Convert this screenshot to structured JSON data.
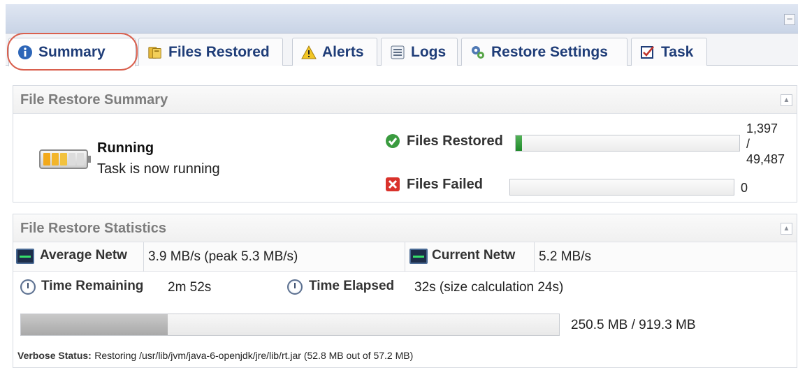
{
  "tabs": [
    {
      "label": "Summary",
      "icon": "info-icon",
      "active": true
    },
    {
      "label": "Files Restored",
      "icon": "folders-icon"
    },
    {
      "label": "Alerts",
      "icon": "warning-icon"
    },
    {
      "label": "Logs",
      "icon": "log-list-icon"
    },
    {
      "label": "Restore Settings",
      "icon": "gear-icon"
    },
    {
      "label": "Task",
      "icon": "task-checkbox-icon"
    }
  ],
  "summary": {
    "title": "File Restore Summary",
    "status_title": "Running",
    "status_text": "Task is now running",
    "files_restored_label": "Files Restored",
    "files_restored_value": "1,397",
    "files_restored_sep": "/",
    "files_restored_total": "49,487",
    "files_restored_fraction": 0.0282,
    "files_failed_label": "Files Failed",
    "files_failed_value": "0",
    "files_failed_fraction": 0
  },
  "stats": {
    "title": "File Restore Statistics",
    "avg_network_label": "Average Netw",
    "avg_network_value": "3.9 MB/s (peak 5.3 MB/s)",
    "current_network_label": "Current Netw",
    "current_network_value": "5.2 MB/s",
    "time_remaining_label": "Time Remaining",
    "time_remaining_value": "2m 52s",
    "time_elapsed_label": "Time Elapsed",
    "time_elapsed_value": "32s (size calculation 24s)",
    "size_text": "250.5 MB / 919.3 MB",
    "size_fraction": 0.2725,
    "verbose_label": "Verbose Status:",
    "verbose_text": "Restoring /usr/lib/jvm/java-6-openjdk/jre/lib/rt.jar (52.8 MB out of 57.2 MB)"
  },
  "colors": {
    "tab_text": "#1f3d78",
    "highlight_ring": "#d9604e",
    "progress_green": "#1f8a2a",
    "failed_red": "#d9322b"
  }
}
